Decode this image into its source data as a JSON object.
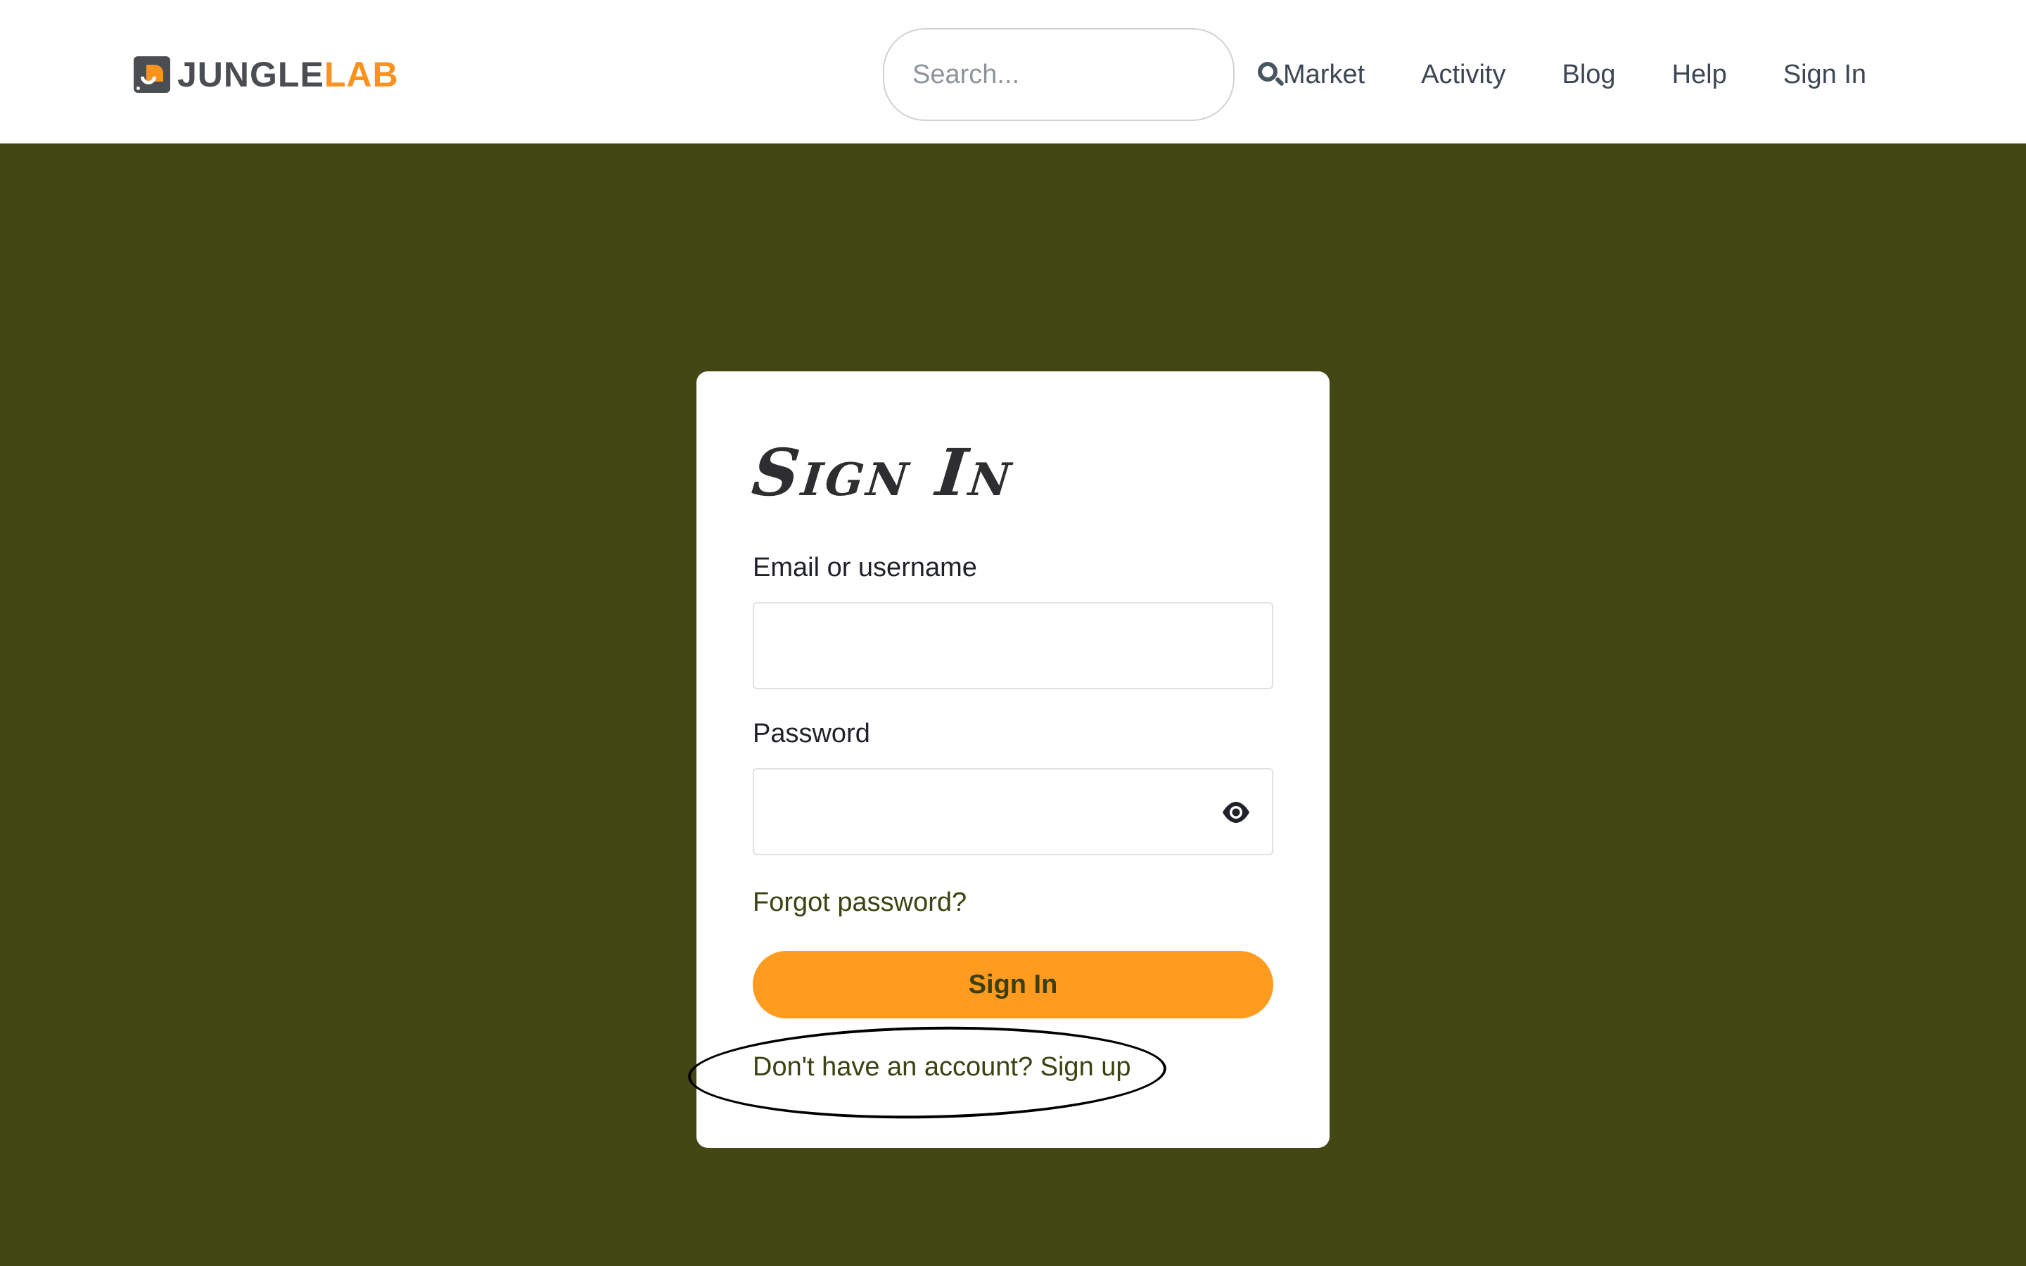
{
  "header": {
    "logo": {
      "text_primary": "JUNGLE",
      "text_accent": "LAB"
    },
    "search": {
      "placeholder": "Search..."
    },
    "nav": [
      {
        "label": "Market"
      },
      {
        "label": "Activity"
      },
      {
        "label": "Blog"
      },
      {
        "label": "Help"
      },
      {
        "label": "Sign In"
      }
    ]
  },
  "form": {
    "title": "Sign In",
    "email_label": "Email or username",
    "email_value": "",
    "password_label": "Password",
    "password_value": "",
    "forgot_link": "Forgot password?",
    "submit_label": "Sign In",
    "signup_link": "Don't have an account? Sign up"
  },
  "colors": {
    "background": "#434714",
    "accent": "#ff9c1f",
    "brand_orange": "#f7931e",
    "brand_gray": "#4a4d52"
  }
}
